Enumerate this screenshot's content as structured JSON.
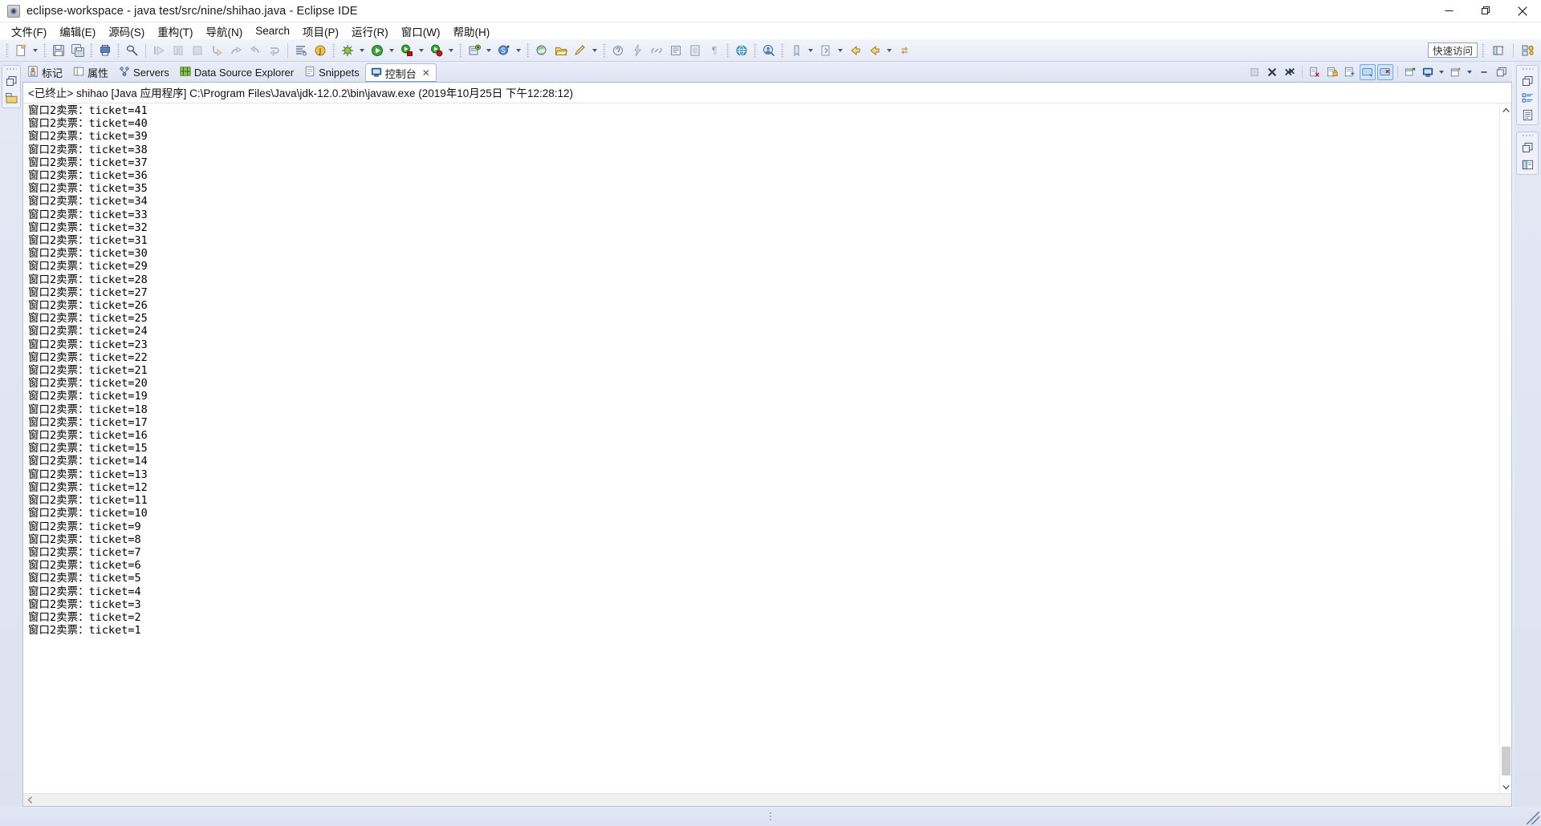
{
  "window": {
    "title": "eclipse-workspace - java test/src/nine/shihao.java - Eclipse IDE",
    "app_icon": "eclipse-icon",
    "controls": {
      "minimize": "minimize-button",
      "maximize": "maximize-button",
      "close": "close-button"
    }
  },
  "menubar": {
    "items": [
      {
        "label": "文件(F)",
        "mnemonic": "F"
      },
      {
        "label": "编辑(E)",
        "mnemonic": "E"
      },
      {
        "label": "源码(S)",
        "mnemonic": "S"
      },
      {
        "label": "重构(T)",
        "mnemonic": "T"
      },
      {
        "label": "导航(N)",
        "mnemonic": "N"
      },
      {
        "label": "Search",
        "mnemonic": "a"
      },
      {
        "label": "项目(P)",
        "mnemonic": "P"
      },
      {
        "label": "运行(R)",
        "mnemonic": "R"
      },
      {
        "label": "窗口(W)",
        "mnemonic": "W"
      },
      {
        "label": "帮助(H)",
        "mnemonic": "H"
      }
    ]
  },
  "toolbar": {
    "quick_access_label": "快速访问",
    "buttons": [
      "new-wizard-button",
      "new-wizard-dropdown",
      "save-button",
      "save-all-button",
      "print-button",
      "toggle-markocc-button",
      "resume-button",
      "suspend-button",
      "terminate-button",
      "step-into-button",
      "step-over-button",
      "step-return-button",
      "drop-to-frame-button",
      "format-button",
      "open-type-button",
      "debug-button",
      "debug-dropdown",
      "run-button",
      "run-dropdown",
      "coverage-button",
      "coverage-dropdown",
      "run-as-button",
      "run-as-dropdown",
      "new-java-project-button",
      "new-java-project-dropdown",
      "new-class-button",
      "new-class-dropdown",
      "search-button",
      "open-resource-button",
      "pencil-button",
      "pencil-dropdown",
      "annotation-button",
      "annotation-dropdown",
      "build-button",
      "link-button",
      "external-tools-button",
      "table-button",
      "pilcrow-button",
      "web-browser-button",
      "profile-button",
      "bookmark-button",
      "bookmark-dropdown",
      "next-annotation-button",
      "next-annotation-dropdown",
      "back-button",
      "forward-button",
      "forward-dropdown",
      "next-edit-button"
    ],
    "right_buttons": [
      "perspective-open-button",
      "java-perspective-button"
    ]
  },
  "view_tabs": {
    "items": [
      {
        "label": "标记",
        "icon": "marker-icon",
        "active": false
      },
      {
        "label": "属性",
        "icon": "properties-icon",
        "active": false
      },
      {
        "label": "Servers",
        "icon": "servers-icon",
        "active": false
      },
      {
        "label": "Data Source Explorer",
        "icon": "datasource-icon",
        "active": false
      },
      {
        "label": "Snippets",
        "icon": "snippets-icon",
        "active": false
      },
      {
        "label": "控制台",
        "icon": "console-icon",
        "active": true,
        "close": "✕"
      }
    ],
    "tools": [
      "terminate-all-icon",
      "remove-launch-icon",
      "remove-all-terminated-icon",
      "clear-console-icon",
      "scroll-lock-icon",
      "word-wrap-icon",
      "show-console-on-output-icon",
      "show-console-on-error-icon",
      "pin-console-icon",
      "display-selected-console-icon",
      "display-selected-dropdown-icon",
      "open-console-icon",
      "open-console-dropdown-icon",
      "minimize-view-icon",
      "maximize-view-icon"
    ]
  },
  "console": {
    "header": "<已终止> shihao [Java 应用程序] C:\\Program Files\\Java\\jdk-12.0.2\\bin\\javaw.exe (2019年10月25日 下午12:28:12)",
    "line_prefix": "窗口2卖票：ticket=",
    "tickets": [
      41,
      40,
      39,
      38,
      37,
      36,
      35,
      34,
      33,
      32,
      31,
      30,
      29,
      28,
      27,
      26,
      25,
      24,
      23,
      22,
      21,
      20,
      19,
      18,
      17,
      16,
      15,
      14,
      13,
      12,
      11,
      10,
      9,
      8,
      7,
      6,
      5,
      4,
      3,
      2,
      1
    ],
    "vscroll": {
      "up_arrow": "▲",
      "down_arrow": "▼"
    },
    "hscroll": {
      "left_arrow": "‹",
      "right_arrow": "›"
    }
  },
  "left_strip": {
    "groups": [
      {
        "restore": "restore-icon",
        "items": [
          "package-explorer-icon"
        ]
      }
    ]
  },
  "right_strip": {
    "groups": [
      {
        "restore": "restore-icon",
        "items": [
          "outline-icon",
          "task-list-icon"
        ]
      },
      {
        "restore": "restore-icon",
        "items": [
          "palette-icon"
        ]
      }
    ]
  },
  "colors": {
    "accent": "#7aa7dd",
    "chrome": "#dfe4f2",
    "console_bg": "#ffffff",
    "text": "#000000",
    "titlebar_bg": "#ffffff"
  }
}
